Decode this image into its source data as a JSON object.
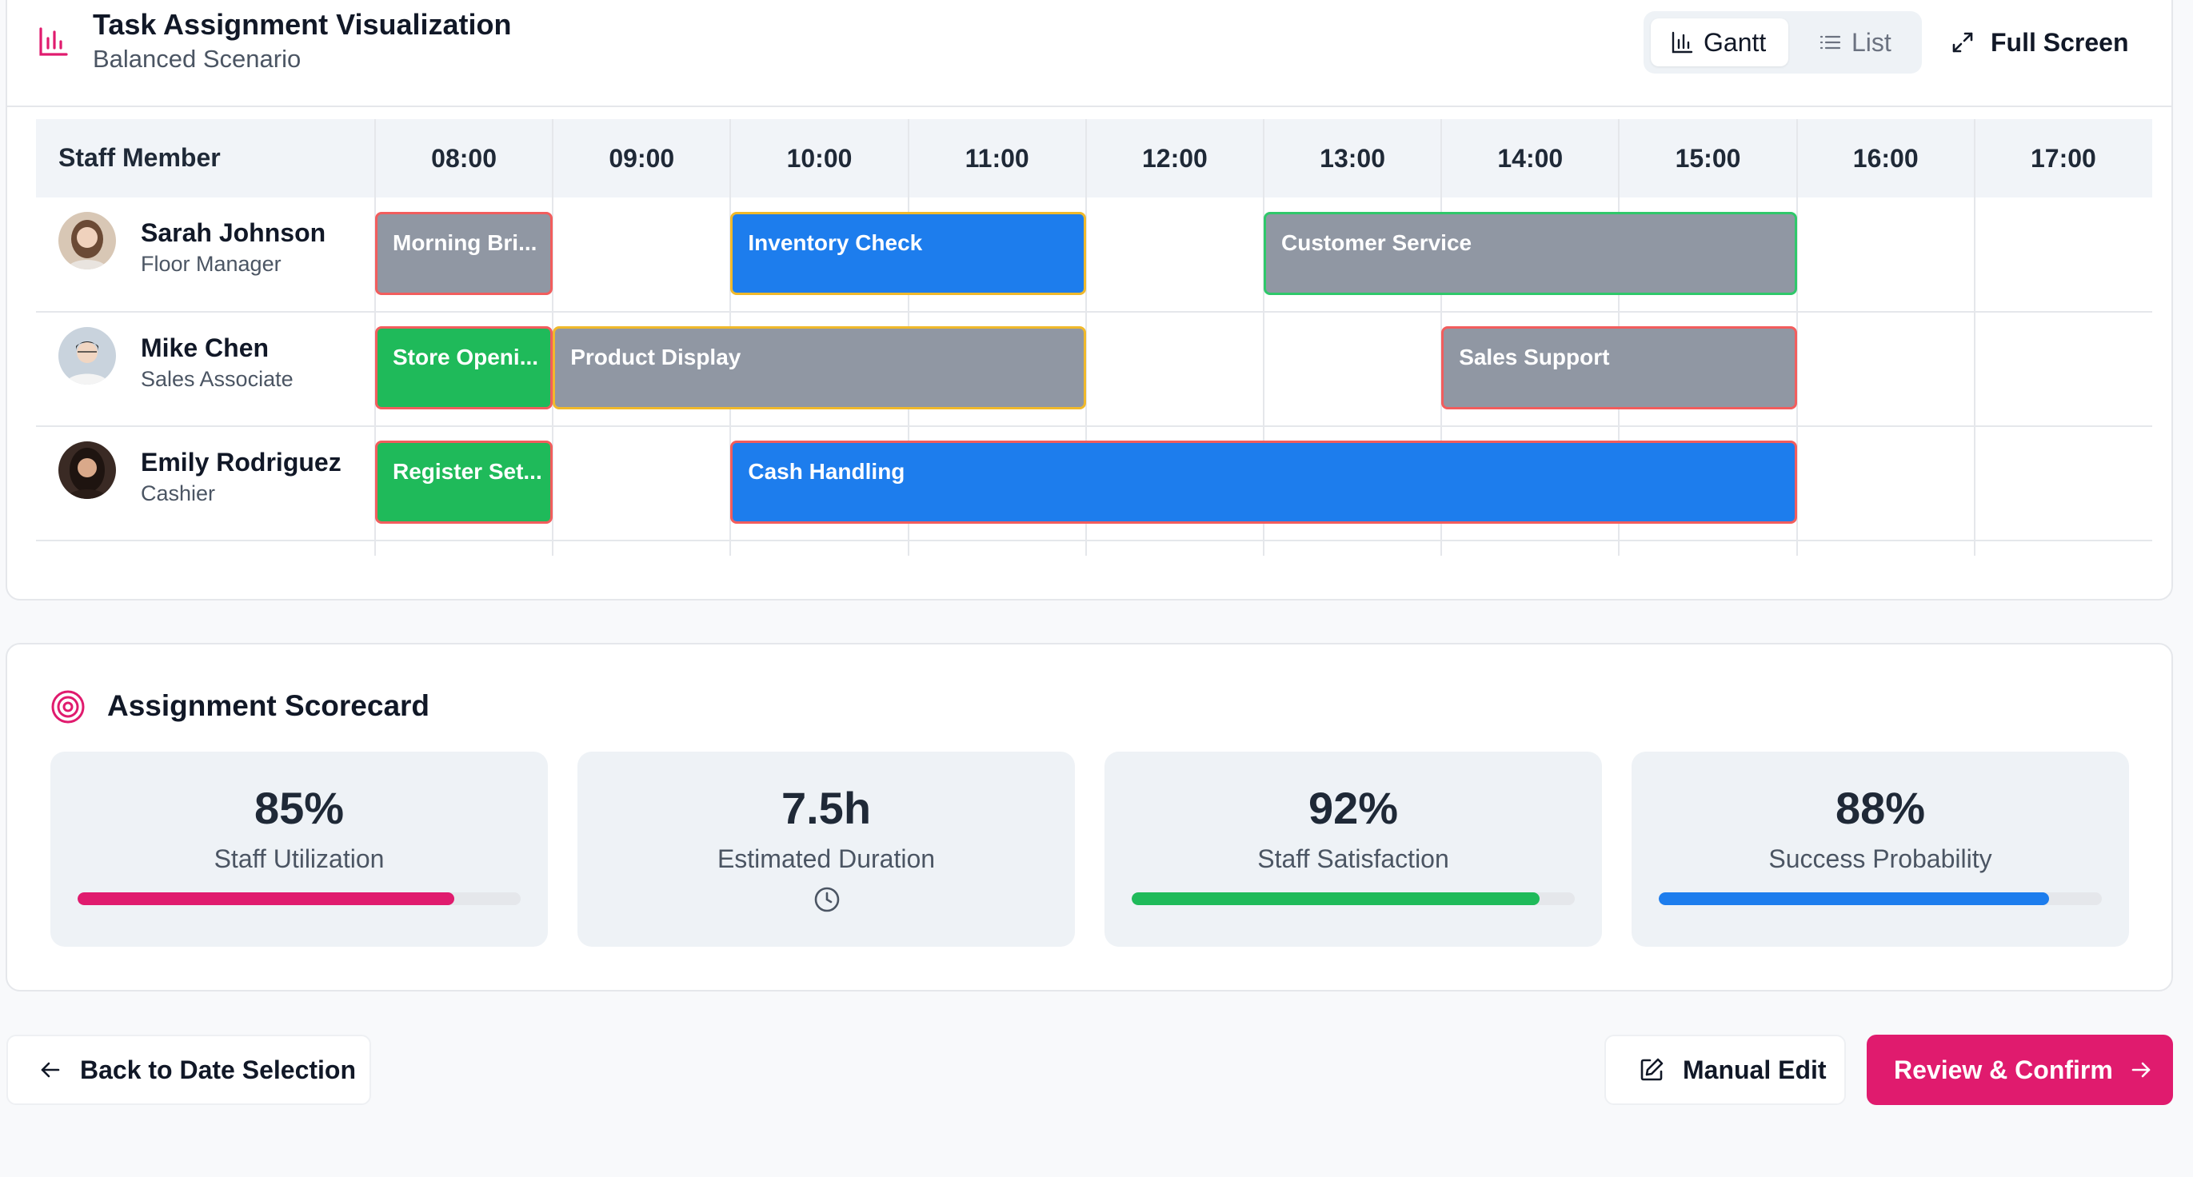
{
  "header": {
    "title": "Task Assignment Visualization",
    "subtitle": "Balanced Scenario",
    "view_gantt": "Gantt",
    "view_list": "List",
    "fullscreen": "Full Screen"
  },
  "gantt": {
    "staff_header": "Staff Member",
    "hours": [
      "08:00",
      "09:00",
      "10:00",
      "11:00",
      "12:00",
      "13:00",
      "14:00",
      "15:00",
      "16:00",
      "17:00"
    ],
    "staff": [
      {
        "name": "Sarah Johnson",
        "role": "Floor Manager",
        "tasks": [
          {
            "label": "Morning Bri...",
            "start": "08:00",
            "end": "09:00",
            "fill": "gray",
            "border": "red"
          },
          {
            "label": "Inventory Check",
            "start": "10:00",
            "end": "12:00",
            "fill": "blue",
            "border": "yellow"
          },
          {
            "label": "Customer Service",
            "start": "13:00",
            "end": "16:00",
            "fill": "gray",
            "border": "green"
          }
        ]
      },
      {
        "name": "Mike Chen",
        "role": "Sales Associate",
        "tasks": [
          {
            "label": "Store Openi...",
            "start": "08:00",
            "end": "09:00",
            "fill": "green",
            "border": "red"
          },
          {
            "label": "Product Display",
            "start": "09:00",
            "end": "12:00",
            "fill": "gray",
            "border": "yellow"
          },
          {
            "label": "Sales Support",
            "start": "14:00",
            "end": "16:00",
            "fill": "gray",
            "border": "red"
          }
        ]
      },
      {
        "name": "Emily Rodriguez",
        "role": "Cashier",
        "tasks": [
          {
            "label": "Register Set...",
            "start": "08:00",
            "end": "09:00",
            "fill": "green",
            "border": "red"
          },
          {
            "label": "Cash Handling",
            "start": "10:00",
            "end": "16:00",
            "fill": "blue",
            "border": "red"
          }
        ]
      }
    ]
  },
  "scorecard": {
    "title": "Assignment Scorecard",
    "metrics": [
      {
        "value": "85%",
        "label": "Staff Utilization",
        "progress": 0.85,
        "color": "#e01b6e"
      },
      {
        "value": "7.5h",
        "label": "Estimated Duration",
        "icon": "clock-icon"
      },
      {
        "value": "92%",
        "label": "Staff Satisfaction",
        "progress": 0.92,
        "color": "#1fba5a"
      },
      {
        "value": "88%",
        "label": "Success Probability",
        "progress": 0.88,
        "color": "#1d7ded"
      }
    ]
  },
  "footer": {
    "back": "Back to Date Selection",
    "manual_edit": "Manual Edit",
    "confirm": "Review & Confirm"
  },
  "colors": {
    "accent": "#e01b6e",
    "task_gray": "#9097a3",
    "task_blue": "#1d7ded",
    "task_green": "#1fba5a",
    "border_red": "#f25d5d",
    "border_yellow": "#f0b92b",
    "border_green": "#2fc86a"
  }
}
